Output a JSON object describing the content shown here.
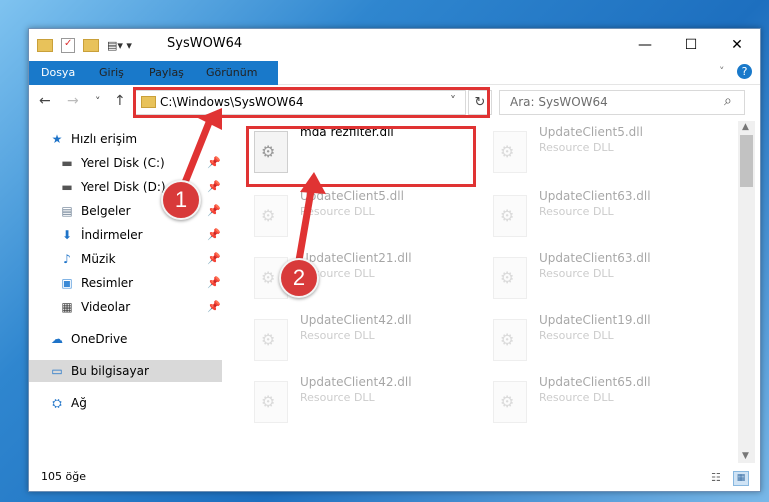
{
  "window": {
    "title": "SysWOW64",
    "minimize": "—",
    "maximize": "☐",
    "close": "✕"
  },
  "ribbon": {
    "tabs": [
      "Dosya",
      "Giriş",
      "Paylaş",
      "Görünüm"
    ],
    "help": "?"
  },
  "nav": {
    "back": "←",
    "forward": "→",
    "up": "↑",
    "recent": "˅"
  },
  "address": {
    "path": "C:\\Windows\\SysWOW64",
    "dropdown": "˅",
    "refresh": "↻"
  },
  "search": {
    "placeholder": "Ara: SysWOW64",
    "icon": "⌕"
  },
  "sidebar": {
    "items": [
      {
        "label": "Hızlı erişim",
        "icon": "★",
        "pin": ""
      },
      {
        "label": "Yerel Disk (C:)",
        "icon": "▬",
        "pin": "📌"
      },
      {
        "label": "Yerel Disk (D:)",
        "icon": "▬",
        "pin": "📌"
      },
      {
        "label": "Belgeler",
        "icon": "▤",
        "pin": "📌"
      },
      {
        "label": "İndirmeler",
        "icon": "⬇",
        "pin": "📌"
      },
      {
        "label": "Müzik",
        "icon": "♪",
        "pin": "📌"
      },
      {
        "label": "Resimler",
        "icon": "▣",
        "pin": "📌"
      },
      {
        "label": "Videolar",
        "icon": "▦",
        "pin": "📌"
      },
      {
        "label": "OneDrive",
        "icon": "☁",
        "pin": ""
      },
      {
        "label": "Bu bilgisayar",
        "icon": "▭",
        "pin": ""
      },
      {
        "label": "Ağ",
        "icon": "⛭",
        "pin": ""
      }
    ]
  },
  "files": {
    "c0": [
      {
        "name": "mda rezfilter.dll",
        "type": ""
      },
      {
        "name": "UpdateClient5.dll",
        "type": "Resource DLL"
      },
      {
        "name": "UpdateClient21.dll",
        "type": "Resource DLL"
      },
      {
        "name": "UpdateClient42.dll",
        "type": "Resource DLL"
      },
      {
        "name": "UpdateClient42.dll",
        "type": "Resource DLL"
      }
    ],
    "c1": [
      {
        "name": "UpdateClient5.dll",
        "type": "Resource DLL"
      },
      {
        "name": "UpdateClient63.dll",
        "type": "Resource DLL"
      },
      {
        "name": "UpdateClient63.dll",
        "type": "Resource DLL"
      },
      {
        "name": "UpdateClient19.dll",
        "type": "Resource DLL"
      },
      {
        "name": "UpdateClient65.dll",
        "type": "Resource DLL"
      }
    ]
  },
  "status": {
    "count": "105 öğe"
  },
  "callouts": [
    "1",
    "2"
  ],
  "colors": {
    "accent": "#1979ca",
    "highlight": "#e03333",
    "badge": "#d83a3a"
  }
}
